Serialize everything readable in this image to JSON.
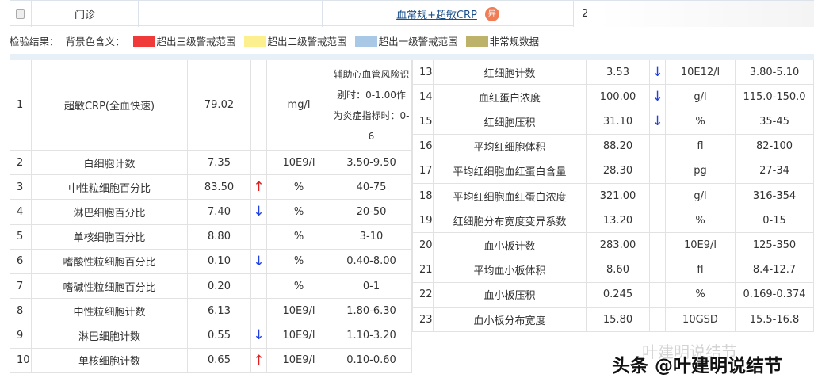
{
  "top_row": {
    "type": "门诊",
    "test_link": "血常规+超敏CRP",
    "badge": "异",
    "date_partial": "2"
  },
  "legend": {
    "label": "检验结果：",
    "meaning": "背景色含义：",
    "items": [
      {
        "color": "#f03a3a",
        "label": "超出三级警戒范围"
      },
      {
        "color": "#fbef8e",
        "label": "超出二级警戒范围"
      },
      {
        "color": "#a9c8e6",
        "label": "超出一级警戒范围"
      },
      {
        "color": "#bdb26a",
        "label": "非常规数据"
      }
    ]
  },
  "left": [
    {
      "no": "1",
      "name": "超敏CRP(全血快速)",
      "value": "79.02",
      "flag": "",
      "unit": "mg/l",
      "range": "辅助心血管风险识别时：0-1.00作为炎症指标时：0-6"
    },
    {
      "no": "2",
      "name": "白细胞计数",
      "value": "7.35",
      "flag": "",
      "unit": "10E9/l",
      "range": "3.50-9.50"
    },
    {
      "no": "3",
      "name": "中性粒细胞百分比",
      "value": "83.50",
      "flag": "up",
      "unit": "%",
      "range": "40-75"
    },
    {
      "no": "4",
      "name": "淋巴细胞百分比",
      "value": "7.40",
      "flag": "down",
      "unit": "%",
      "range": "20-50"
    },
    {
      "no": "5",
      "name": "单核细胞百分比",
      "value": "8.80",
      "flag": "",
      "unit": "%",
      "range": "3-10"
    },
    {
      "no": "6",
      "name": "嗜酸性粒细胞百分比",
      "value": "0.10",
      "flag": "down",
      "unit": "%",
      "range": "0.40-8.00"
    },
    {
      "no": "7",
      "name": "嗜碱性粒细胞百分比",
      "value": "0.20",
      "flag": "",
      "unit": "%",
      "range": "0-1"
    },
    {
      "no": "8",
      "name": "中性粒细胞计数",
      "value": "6.13",
      "flag": "",
      "unit": "10E9/l",
      "range": "1.80-6.30"
    },
    {
      "no": "9",
      "name": "淋巴细胞计数",
      "value": "0.55",
      "flag": "down",
      "unit": "10E9/l",
      "range": "1.10-3.20"
    },
    {
      "no": "10",
      "name": "单核细胞计数",
      "value": "0.65",
      "flag": "up",
      "unit": "10E9/l",
      "range": "0.10-0.60"
    }
  ],
  "right": [
    {
      "no": "13",
      "name": "红细胞计数",
      "value": "3.53",
      "flag": "down",
      "unit": "10E12/l",
      "range": "3.80-5.10"
    },
    {
      "no": "14",
      "name": "血红蛋白浓度",
      "value": "100.00",
      "flag": "down",
      "unit": "g/l",
      "range": "115.0-150.0"
    },
    {
      "no": "15",
      "name": "红细胞压积",
      "value": "31.10",
      "flag": "down",
      "unit": "%",
      "range": "35-45"
    },
    {
      "no": "16",
      "name": "平均红细胞体积",
      "value": "88.20",
      "flag": "",
      "unit": "fl",
      "range": "82-100"
    },
    {
      "no": "17",
      "name": "平均红细胞血红蛋白含量",
      "value": "28.30",
      "flag": "",
      "unit": "pg",
      "range": "27-34"
    },
    {
      "no": "18",
      "name": "平均红细胞血红蛋白浓度",
      "value": "321.00",
      "flag": "",
      "unit": "g/l",
      "range": "316-354"
    },
    {
      "no": "19",
      "name": "红细胞分布宽度变异系数",
      "value": "13.20",
      "flag": "",
      "unit": "%",
      "range": "0-15"
    },
    {
      "no": "20",
      "name": "血小板计数",
      "value": "283.00",
      "flag": "",
      "unit": "10E9/l",
      "range": "125-350"
    },
    {
      "no": "21",
      "name": "平均血小板体积",
      "value": "8.60",
      "flag": "",
      "unit": "fl",
      "range": "8.4-12.7"
    },
    {
      "no": "22",
      "name": "血小板压积",
      "value": "0.245",
      "flag": "",
      "unit": "%",
      "range": "0.169-0.374"
    },
    {
      "no": "23",
      "name": "血小板分布宽度",
      "value": "15.80",
      "flag": "",
      "unit": "10GSD",
      "range": "15.5-16.8"
    }
  ],
  "arrows": {
    "up": "↑",
    "down": "↓"
  },
  "watermark": {
    "small": "叶建明说结节",
    "large": "头条 @叶建明说结节"
  }
}
